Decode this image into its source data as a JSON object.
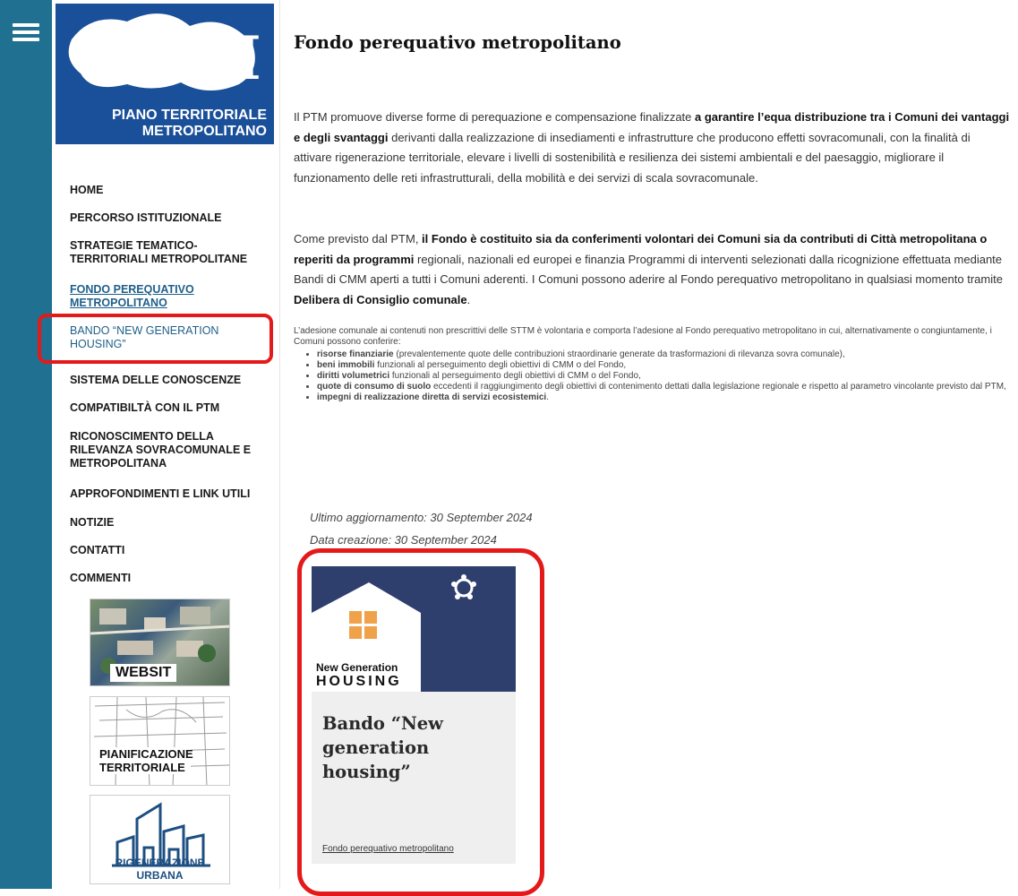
{
  "colors": {
    "rail": "#1f7091",
    "logo_bg": "#1a4f99",
    "link": "#1f5f8a",
    "highlight": "#e41a1a",
    "card_header": "#2e3f6e"
  },
  "logo": {
    "mark": "PTM",
    "line1": "PIANO TERRITORIALE",
    "line2": "METROPOLITANO"
  },
  "nav": [
    {
      "label": "HOME"
    },
    {
      "label": "PERCORSO ISTITUZIONALE"
    },
    {
      "label": "STRATEGIE TEMATICO-TERRITORIALI METROPOLITANE"
    },
    {
      "label": "FONDO PEREQUATIVO METROPOLITANO"
    },
    {
      "label": "BANDO “NEW GENERATION HOUSING”"
    },
    {
      "label": "SISTEMA DELLE CONOSCENZE"
    },
    {
      "label": "COMPATIBILTÀ CON IL PTM"
    },
    {
      "label": "RICONOSCIMENTO DELLA RILEVANZA SOVRACOMUNALE E METROPOLITANA"
    },
    {
      "label": "APPROFONDIMENTI E LINK UTILI"
    },
    {
      "label": "NOTIZIE"
    },
    {
      "label": "CONTATTI"
    },
    {
      "label": "COMMENTI"
    }
  ],
  "thumbs": [
    {
      "caption": "WEBSIT",
      "icon": "aerial-photo"
    },
    {
      "caption": "PIANIFICAZIONE TERRITORIALE",
      "icon": "cadastral-map"
    },
    {
      "caption": "RIGENERAZIONE URBANA",
      "icon": "buildings-outline"
    }
  ],
  "page": {
    "title": "Fondo perequativo metropolitano",
    "p1": {
      "a": "Il PTM promuove diverse forme di perequazione e compensazione finalizzate ",
      "b": "a garantire l’equa distribuzione tra i Comuni dei vantaggi e degli svantaggi",
      "c": " derivanti dalla realizzazione di insediamenti e infrastrutture che producono effetti sovracomunali, con la finalità di attivare rigenerazione territoriale, elevare i livelli di sostenibilità e resilienza dei sistemi ambientali e del paesaggio, migliorare il funzionamento delle reti infrastrutturali, della mobilità e dei servizi di scala sovracomunale."
    },
    "p2": {
      "a": "Come previsto dal PTM, ",
      "b": "il Fondo è costituito sia da conferimenti volontari dei Comuni sia da contributi di Città metropolitana o reperiti da programmi",
      "c": " regionali, nazionali ed europei e finanzia Programmi di interventi selezionati dalla ricognizione effettuata mediante Bandi di CMM aperti a tutti i Comuni aderenti. I Comuni possono aderire al Fondo perequativo metropolitano in qualsiasi momento tramite ",
      "d": "Delibera di Consiglio comunale",
      "e": "."
    },
    "small_intro": "L’adesione comunale ai contenuti non prescrittivi delle STTM è volontaria e comporta l’adesione al Fondo perequativo metropolitano in cui, alternativamente o congiuntamente, i Comuni possono conferire:",
    "bullets": [
      {
        "b": "risorse finanziarie",
        "t": " (prevalentemente quote delle contribuzioni straordinarie generate da trasformazioni di rilevanza sovra comunale),"
      },
      {
        "b": "beni immobili",
        "t": " funzionali al perseguimento degli obiettivi di CMM o del Fondo,"
      },
      {
        "b": "diritti volumetrici",
        "t": " funzionali al perseguimento degli obiettivi di CMM o del Fondo,"
      },
      {
        "b": "quote di consumo di suolo",
        "t": " eccedenti il raggiungimento degli obiettivi di contenimento dettati dalla legislazione regionale e rispetto al parametro vincolante previsto dal PTM,"
      },
      {
        "b": "impegni di realizzazione diretta di servizi ecosistemici",
        "t": "."
      }
    ],
    "updated": "Ultimo aggiornamento: 30 September 2024",
    "created": "Data creazione: 30 September 2024"
  },
  "card": {
    "brand_line1": "New Generation",
    "brand_line2": "HOUSING",
    "title": "Bando “New generation housing”",
    "category": "Fondo perequativo metropolitano"
  }
}
